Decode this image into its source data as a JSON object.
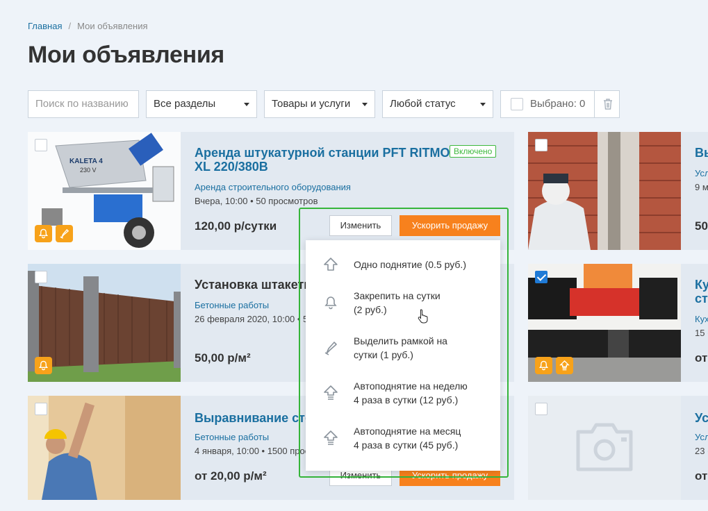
{
  "breadcrumb": {
    "home": "Главная",
    "separator": "/",
    "current": "Мои объявления"
  },
  "page_title": "Мои объявления",
  "filters": {
    "search_placeholder": "Поиск по названию",
    "section": "Все разделы",
    "type": "Товары и услуги",
    "status": "Любой статус",
    "selected": "Выбрано: 0"
  },
  "listings": [
    {
      "title_line1": "Аренда штукатурной станции PFT RITMO",
      "title_line2": "XL 220/380В",
      "status": "Включено",
      "category": "Аренда строительного оборудования",
      "meta": "Вчера, 10:00 • 50 просмотров",
      "price": "120,00 р/сутки",
      "edit": "Изменить",
      "boost": "Ускорить продажу",
      "checked": false
    },
    {
      "title": "Установка штакетн",
      "category": "Бетонные работы",
      "meta": "26 февраля 2020, 10:00 • 5",
      "price": "50,00 р/м²",
      "checked": false
    },
    {
      "title": "Выравнивание сте",
      "category": "Бетонные работы",
      "meta": "4 января, 10:00 • 1500 прос",
      "price": "от 20,00 р/м²",
      "edit": "Изменить",
      "boost": "Ускорить продажу",
      "checked": false
    },
    {
      "title": "Вы",
      "category": "Усл",
      "meta": "9 м",
      "price": "50",
      "checked": false
    },
    {
      "title_line1": "Ку",
      "title_line2": "ст",
      "category": "Кух",
      "meta": "15 (",
      "price": "от",
      "checked": true
    },
    {
      "title": "Ус",
      "category": "Усл",
      "meta": "23 (",
      "price": "от",
      "checked": false
    }
  ],
  "boost_menu": [
    {
      "icon": "arrow-up-icon",
      "label": "Одно поднятие (0.5 руб.)"
    },
    {
      "icon": "pin-bell-icon",
      "label": "Закрепить на сутки\n(2 руб.)"
    },
    {
      "icon": "highlight-frame-icon",
      "label": "Выделить рамкой на\nсутки (1 руб.)"
    },
    {
      "icon": "auto-lift-icon",
      "label": "Автоподнятие на неделю\n4 раза в сутки (12 руб.)"
    },
    {
      "icon": "auto-lift-icon",
      "label": "Автоподнятие на месяц\n4 раза в сутки (45 руб.)"
    }
  ],
  "colors": {
    "accent": "#1a6fa0",
    "orange": "#f7811d",
    "green": "#35b53a",
    "badge": "#f7a21a",
    "checkbox": "#1f7ad6"
  }
}
